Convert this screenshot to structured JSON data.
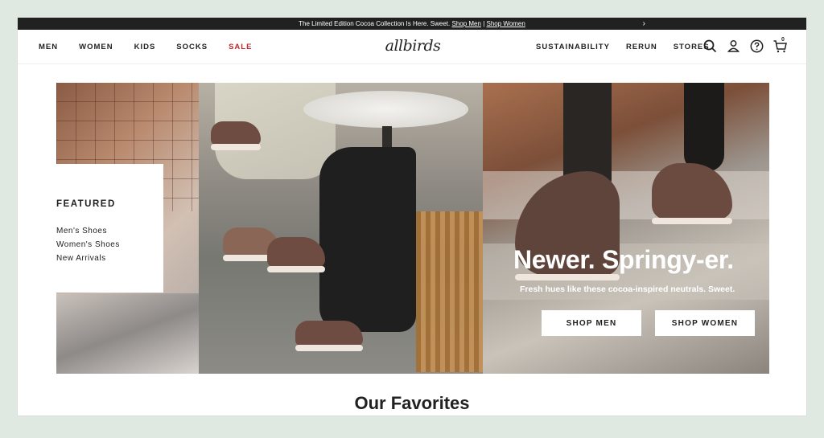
{
  "announcement": {
    "text": "The Limited Edition Cocoa Collection Is Here. Sweet.",
    "link_men": "Shop Men",
    "separator": "|",
    "link_women": "Shop Women",
    "chevron": "›"
  },
  "nav": {
    "left": [
      "MEN",
      "WOMEN",
      "KIDS",
      "SOCKS",
      "SALE"
    ],
    "logo": "allbirds",
    "right": [
      "SUSTAINABILITY",
      "RERUN",
      "STORES"
    ],
    "cart_count": "0"
  },
  "icons": [
    "search-icon",
    "account-icon",
    "help-icon",
    "cart-icon"
  ],
  "featured": {
    "heading": "FEATURED",
    "links": [
      "Men's Shoes",
      "Women's Shoes",
      "New Arrivals"
    ]
  },
  "hero": {
    "title": "Newer. Springy-er.",
    "subtitle": "Fresh hues like these cocoa-inspired neutrals. Sweet.",
    "button_men": "SHOP MEN",
    "button_women": "SHOP WOMEN"
  },
  "section": {
    "favorites_title": "Our Favorites"
  },
  "colors": {
    "sale": "#c1272d",
    "announcement_bg": "#212121",
    "page_bg": "#dfe9e1"
  }
}
